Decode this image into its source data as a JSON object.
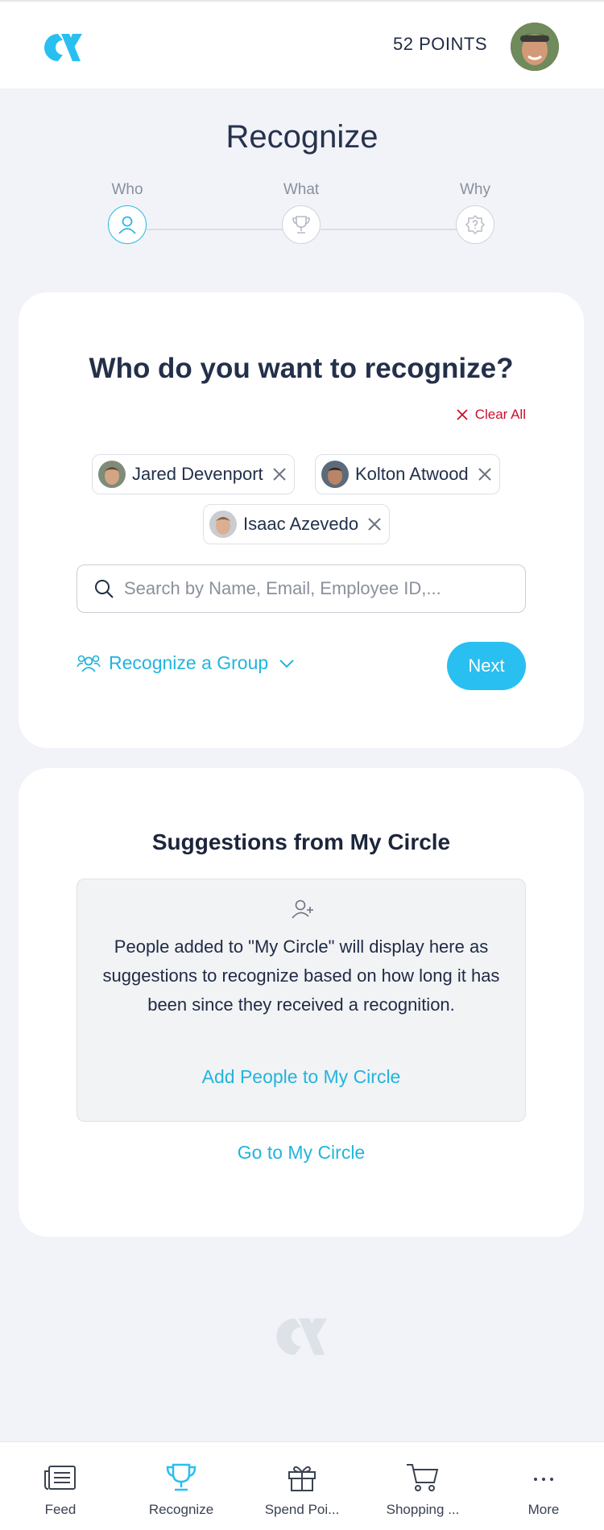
{
  "header": {
    "points": "52 POINTS"
  },
  "page_title": "Recognize",
  "steps": [
    {
      "label": "Who"
    },
    {
      "label": "What"
    },
    {
      "label": "Why"
    }
  ],
  "who_card": {
    "title": "Who do you want to recognize?",
    "clear_all": "Clear All",
    "chips": [
      {
        "name": "Jared Devenport"
      },
      {
        "name": "Kolton Atwood"
      },
      {
        "name": "Isaac Azevedo"
      }
    ],
    "search_placeholder": "Search by Name, Email, Employee ID,...",
    "group_label": "Recognize a Group",
    "next_label": "Next"
  },
  "suggestions": {
    "title": "Suggestions from My Circle",
    "description": "People added to \"My Circle\" will display here as suggestions to recognize based on how long it has been since they received a recognition.",
    "add_link": "Add People to My Circle",
    "go_link": "Go to My Circle"
  },
  "nav": [
    {
      "label": "Feed",
      "icon": "newspaper-icon"
    },
    {
      "label": "Recognize",
      "icon": "trophy-icon"
    },
    {
      "label": "Spend Poi...",
      "icon": "gift-icon"
    },
    {
      "label": "Shopping ...",
      "icon": "cart-icon"
    },
    {
      "label": "More",
      "icon": "more-icon"
    }
  ],
  "colors": {
    "accent": "#29bff0",
    "danger": "#c8102e",
    "text": "#1f2a44"
  }
}
